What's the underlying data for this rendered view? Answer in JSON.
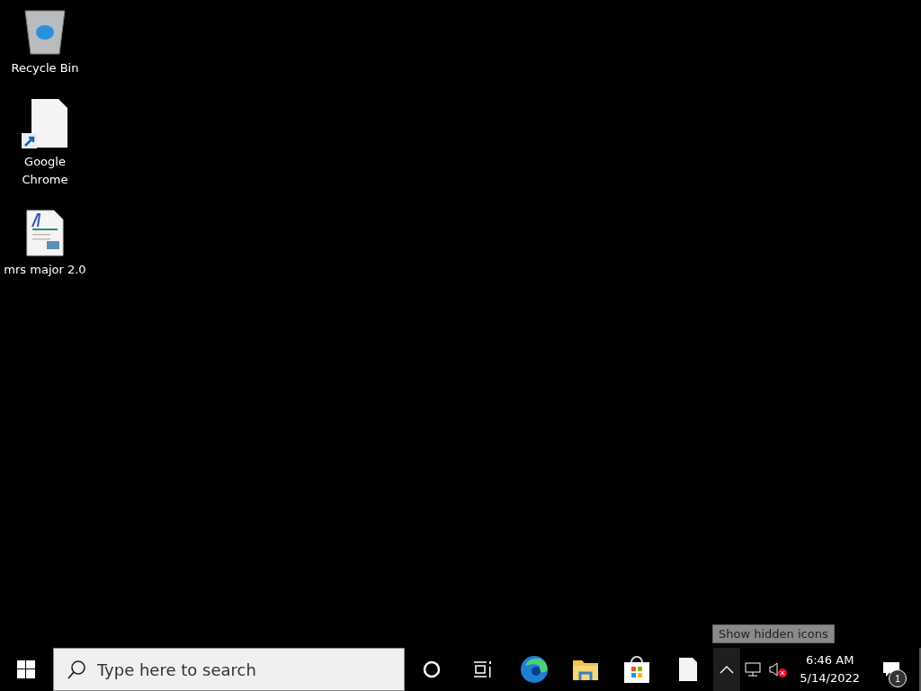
{
  "desktop_icons": [
    {
      "kind": "recycle",
      "label": "Recycle Bin"
    },
    {
      "kind": "shortcut",
      "label": "Google Chrome"
    },
    {
      "kind": "document",
      "label": "mrs major 2.0"
    }
  ],
  "taskbar": {
    "search": {
      "placeholder": "Type here to search"
    },
    "apps": [
      {
        "kind": "cortana"
      },
      {
        "kind": "taskview"
      },
      {
        "kind": "edge"
      },
      {
        "kind": "explorer"
      },
      {
        "kind": "store"
      },
      {
        "kind": "blank"
      }
    ],
    "tray": {
      "tooltip": "Show hidden icons",
      "time": "6:46 AM",
      "date": "5/14/2022",
      "notifications": "1"
    }
  }
}
